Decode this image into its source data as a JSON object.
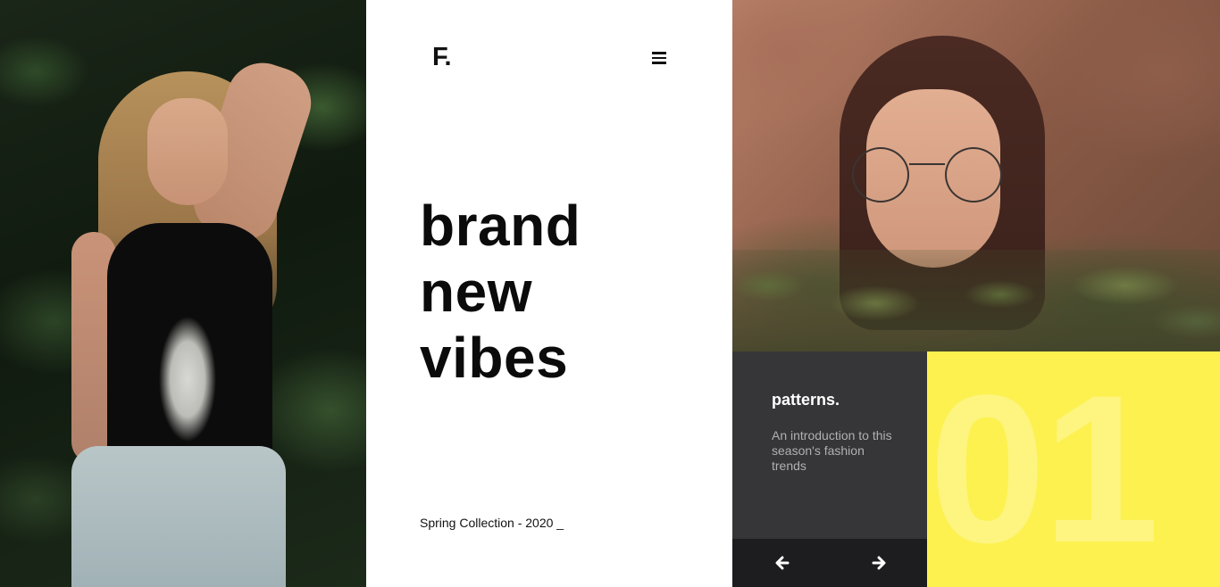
{
  "brand": {
    "logo": "F."
  },
  "hero": {
    "headline_lines": [
      "brand",
      "new",
      "vibes"
    ],
    "subtitle": "Spring Collection - 2020 _"
  },
  "feature": {
    "title": "patterns.",
    "description": "An introduction to this season's fashion trends",
    "number": "01"
  },
  "icons": {
    "menu": "hamburger-menu-icon",
    "prev": "arrow-left-icon",
    "next": "arrow-right-icon"
  },
  "colors": {
    "accent": "#fdf150",
    "card_dark": "#363638",
    "nav_dark": "#1d1d1f",
    "text": "#0b0b0b"
  }
}
